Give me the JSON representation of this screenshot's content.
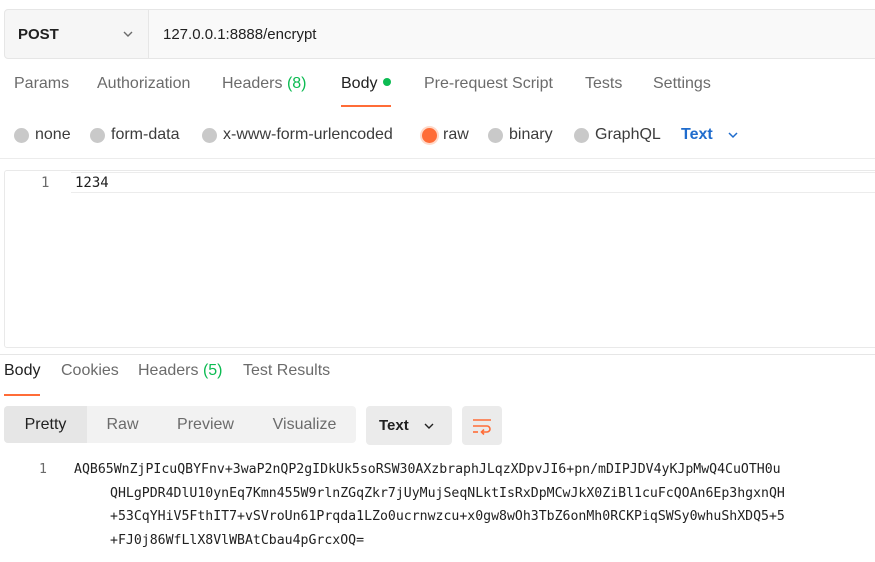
{
  "request": {
    "method": "POST",
    "url": "127.0.0.1:8888/encrypt"
  },
  "request_tabs": [
    {
      "label": "Params"
    },
    {
      "label": "Authorization"
    },
    {
      "label": "Headers",
      "count": "(8)"
    },
    {
      "label": "Body",
      "active": true
    },
    {
      "label": "Pre-request Script"
    },
    {
      "label": "Tests"
    },
    {
      "label": "Settings"
    }
  ],
  "body_options": {
    "items": [
      "none",
      "form-data",
      "x-www-form-urlencoded",
      "raw",
      "binary",
      "GraphQL"
    ],
    "selected": "raw",
    "format": "Text"
  },
  "editor": {
    "line_number": "1",
    "content": "1234"
  },
  "response_tabs": [
    {
      "label": "Body",
      "active": true
    },
    {
      "label": "Cookies"
    },
    {
      "label": "Headers",
      "count": "(5)"
    },
    {
      "label": "Test Results"
    }
  ],
  "response_view": {
    "modes": [
      "Pretty",
      "Raw",
      "Preview",
      "Visualize"
    ],
    "active_mode": "Pretty",
    "format": "Text"
  },
  "response_body": {
    "line_number": "1",
    "lines": [
      "AQB65WnZjPIcuQBYFnv+3waP2nQP2gIDkUk5soRSW30AXzbraphJLqzXDpvJI6+pn/mDIPJDV4yKJpMwQ4CuOTH0u",
      "QHLgPDR4DlU10ynEq7Kmn455W9rlnZGqZkr7jUyMujSeqNLktIsRxDpMCwJkX0ZiBl1cuFcQOAn6Ep3hgxnQH",
      "+53CqYHiV5FthIT7+vSVroUn61Prqda1LZo0ucrnwzcu+x0gw8wOh3TbZ6onMh0RCKPiqSWSy0whuShXDQ5+5",
      "+FJ0j86WfLlX8VlWBAtCbau4pGrcxOQ="
    ]
  },
  "colors": {
    "accent": "#ff6c37",
    "success": "#0cbb52",
    "link": "#1f6ccd"
  }
}
